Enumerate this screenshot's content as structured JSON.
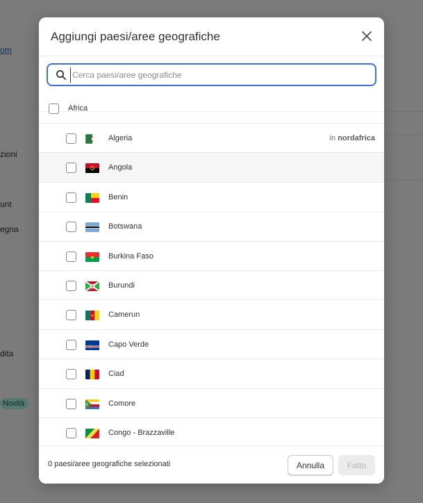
{
  "background": {
    "link_text": "om",
    "items": [
      "zioni",
      "unt",
      "egna",
      "dita"
    ],
    "badge": "Novità"
  },
  "modal": {
    "title": "Aggiungi paesi/aree geografiche",
    "search": {
      "value": "",
      "placeholder": "Cerca paesi/aree geografiche"
    },
    "region": {
      "label": "Africa"
    },
    "countries": [
      {
        "name": "Algeria",
        "note_prefix": "in",
        "note_region": "nordafrica",
        "flag": "algeria"
      },
      {
        "name": "Angola",
        "flag": "angola"
      },
      {
        "name": "Benin",
        "flag": "benin"
      },
      {
        "name": "Botswana",
        "flag": "botswana"
      },
      {
        "name": "Burkina Faso",
        "flag": "burkina-faso"
      },
      {
        "name": "Burundi",
        "flag": "burundi"
      },
      {
        "name": "Camerun",
        "flag": "cameroon"
      },
      {
        "name": "Capo Verde",
        "flag": "cape-verde"
      },
      {
        "name": "Ciad",
        "flag": "chad"
      },
      {
        "name": "Comore",
        "flag": "comoros"
      },
      {
        "name": "Congo - Brazzaville",
        "flag": "congo-brazzaville"
      }
    ],
    "footer": {
      "status": "0 paesi/aree geografiche selezionati",
      "cancel_label": "Annulla",
      "done_label": "Fatto"
    }
  },
  "colors": {
    "accent": "#3d6fd4",
    "text": "#303030",
    "muted": "#6d6d6d",
    "overlay": "#7b7b7b",
    "badge_bg": "#a9e9d8"
  }
}
